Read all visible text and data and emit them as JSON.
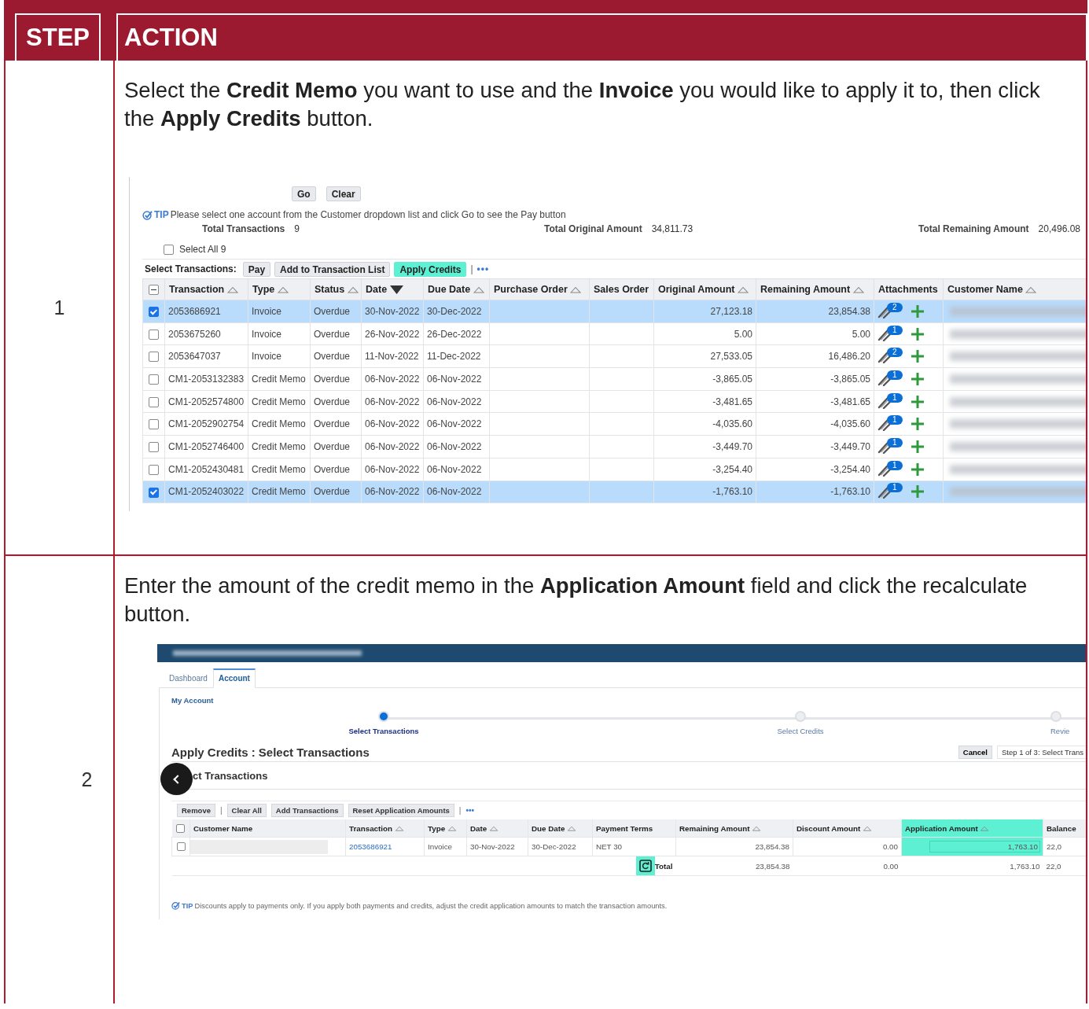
{
  "header": {
    "step": "STEP",
    "action": "ACTION"
  },
  "steps": [
    {
      "number": "1",
      "instruction": "Select the **Credit Memo** you want to use and the **Invoice** you would like to apply it to, then click the **Apply Credits** button.",
      "screenshot": {
        "kind": "transactions",
        "buttons": [
          "Go",
          "Clear"
        ],
        "tip": {
          "label": "TIP",
          "text": "Please select one account from the Customer dropdown list and click Go to see the Pay button"
        },
        "totals": [
          {
            "label": "Total Transactions",
            "value": "9"
          },
          {
            "label": "Total Original Amount",
            "value": "34,811.73"
          },
          {
            "label": "Total Remaining Amount",
            "value": "20,496.08"
          }
        ],
        "select_all": {
          "label": "Select All 9",
          "checked": false
        },
        "toolbar": {
          "label": "Select Transactions:",
          "separator": "|",
          "more": "•••",
          "actions": [
            {
              "label": "Pay",
              "highlighted": false
            },
            {
              "label": "Add to Transaction List",
              "highlighted": false
            },
            {
              "label": "Apply Credits",
              "highlighted": true
            }
          ]
        },
        "header_checkbox_partial": true,
        "columns": [
          {
            "label": "Transaction",
            "sortable": true,
            "descending": false
          },
          {
            "label": "Type",
            "sortable": true,
            "descending": false
          },
          {
            "label": "Status",
            "sortable": true,
            "descending": false
          },
          {
            "label": "Date",
            "sortable": true,
            "descending": true
          },
          {
            "label": "Due Date",
            "sortable": true,
            "descending": false
          },
          {
            "label": "Purchase Order",
            "sortable": true,
            "descending": false
          },
          {
            "label": "Sales Order",
            "sortable": false,
            "descending": false
          },
          {
            "label": "Original Amount",
            "sortable": true,
            "descending": false
          },
          {
            "label": "Remaining Amount",
            "sortable": true,
            "descending": false
          },
          {
            "label": "Attachments",
            "sortable": false,
            "descending": false
          },
          {
            "label": "Customer Name",
            "sortable": true,
            "descending": false
          }
        ],
        "rows": [
          {
            "selected": true,
            "transaction": "2053686921",
            "type": "Invoice",
            "status": "Overdue",
            "date": "30-Nov-2022",
            "due_date": "30-Dec-2022",
            "original_amount": "27,123.18",
            "remaining_amount": "23,854.38",
            "attachments": "2"
          },
          {
            "selected": false,
            "transaction": "2053675260",
            "type": "Invoice",
            "status": "Overdue",
            "date": "26-Nov-2022",
            "due_date": "26-Dec-2022",
            "original_amount": "5.00",
            "remaining_amount": "5.00",
            "attachments": "1"
          },
          {
            "selected": false,
            "transaction": "2053647037",
            "type": "Invoice",
            "status": "Overdue",
            "date": "11-Nov-2022",
            "due_date": "11-Dec-2022",
            "original_amount": "27,533.05",
            "remaining_amount": "16,486.20",
            "attachments": "2"
          },
          {
            "selected": false,
            "transaction": "CM1-2053132383",
            "type": "Credit Memo",
            "status": "Overdue",
            "date": "06-Nov-2022",
            "due_date": "06-Nov-2022",
            "original_amount": "-3,865.05",
            "remaining_amount": "-3,865.05",
            "attachments": "1"
          },
          {
            "selected": false,
            "transaction": "CM1-2052574800",
            "type": "Credit Memo",
            "status": "Overdue",
            "date": "06-Nov-2022",
            "due_date": "06-Nov-2022",
            "original_amount": "-3,481.65",
            "remaining_amount": "-3,481.65",
            "attachments": "1"
          },
          {
            "selected": false,
            "transaction": "CM1-2052902754",
            "type": "Credit Memo",
            "status": "Overdue",
            "date": "06-Nov-2022",
            "due_date": "06-Nov-2022",
            "original_amount": "-4,035.60",
            "remaining_amount": "-4,035.60",
            "attachments": "1"
          },
          {
            "selected": false,
            "transaction": "CM1-2052746400",
            "type": "Credit Memo",
            "status": "Overdue",
            "date": "06-Nov-2022",
            "due_date": "06-Nov-2022",
            "original_amount": "-3,449.70",
            "remaining_amount": "-3,449.70",
            "attachments": "1"
          },
          {
            "selected": false,
            "transaction": "CM1-2052430481",
            "type": "Credit Memo",
            "status": "Overdue",
            "date": "06-Nov-2022",
            "due_date": "06-Nov-2022",
            "original_amount": "-3,254.40",
            "remaining_amount": "-3,254.40",
            "attachments": "1"
          },
          {
            "selected": true,
            "transaction": "CM1-2052403022",
            "type": "Credit Memo",
            "status": "Overdue",
            "date": "06-Nov-2022",
            "due_date": "06-Nov-2022",
            "original_amount": "-1,763.10",
            "remaining_amount": "-1,763.10",
            "attachments": "1"
          }
        ]
      }
    },
    {
      "number": "2",
      "instruction": "Enter the amount of the credit memo in the **Application Amount** field and click the recalculate button.",
      "screenshot": {
        "kind": "apply_credits",
        "tabs": [
          {
            "label": "Dashboard",
            "selected": false
          },
          {
            "label": "Account",
            "selected": true
          }
        ],
        "breadcrumb": "My Account",
        "train": [
          {
            "label": "Select Transactions",
            "selected": true
          },
          {
            "label": "Select Credits",
            "selected": false
          },
          {
            "label": "Revie",
            "selected": false
          }
        ],
        "title": "Apply Credits : Select Transactions",
        "cancel": "Cancel",
        "step_indicator": "Step 1 of 3: Select Trans",
        "section_title": "ct Transactions",
        "toolbar": [
          {
            "kind": "button",
            "label": "Remove"
          },
          {
            "kind": "separator",
            "label": "|"
          },
          {
            "kind": "button",
            "label": "Clear All"
          },
          {
            "kind": "button",
            "label": "Add Transactions"
          },
          {
            "kind": "button",
            "label": "Reset Application Amounts"
          },
          {
            "kind": "separator",
            "label": "|"
          },
          {
            "kind": "more",
            "label": "•••"
          }
        ],
        "header_checked": false,
        "columns": [
          {
            "label": "Customer Name",
            "sortable": false,
            "highlighted": false
          },
          {
            "label": "Transaction",
            "sortable": true,
            "highlighted": false
          },
          {
            "label": "Type",
            "sortable": true,
            "highlighted": false
          },
          {
            "label": "Date",
            "sortable": true,
            "highlighted": false
          },
          {
            "label": "Due Date",
            "sortable": true,
            "highlighted": false
          },
          {
            "label": "Payment Terms",
            "sortable": false,
            "highlighted": false
          },
          {
            "label": "Remaining Amount",
            "sortable": true,
            "highlighted": false
          },
          {
            "label": "Discount Amount",
            "sortable": true,
            "highlighted": false
          },
          {
            "label": "Application Amount",
            "sortable": true,
            "highlighted": true
          },
          {
            "label": "Balance",
            "sortable": false,
            "highlighted": false
          }
        ],
        "row": {
          "checked": false,
          "transaction": "2053686921",
          "type": "Invoice",
          "date": "30-Nov-2022",
          "due_date": "30-Dec-2022",
          "payment_terms": "NET 30",
          "remaining_amount": "23,854.38",
          "discount_amount": "0.00",
          "application_amount": "1,763.10",
          "balance": "22,0"
        },
        "total": {
          "label": "Total",
          "recalculate_highlighted": true,
          "remaining_amount": "23,854.38",
          "discount_amount": "0.00",
          "application_amount": "1,763.10",
          "balance": "22,0"
        },
        "tip": {
          "label": "TIP",
          "text": "Discounts apply to payments only. If you apply both payments and credits, adjust the credit application amounts to match the transaction amounts."
        }
      }
    }
  ]
}
